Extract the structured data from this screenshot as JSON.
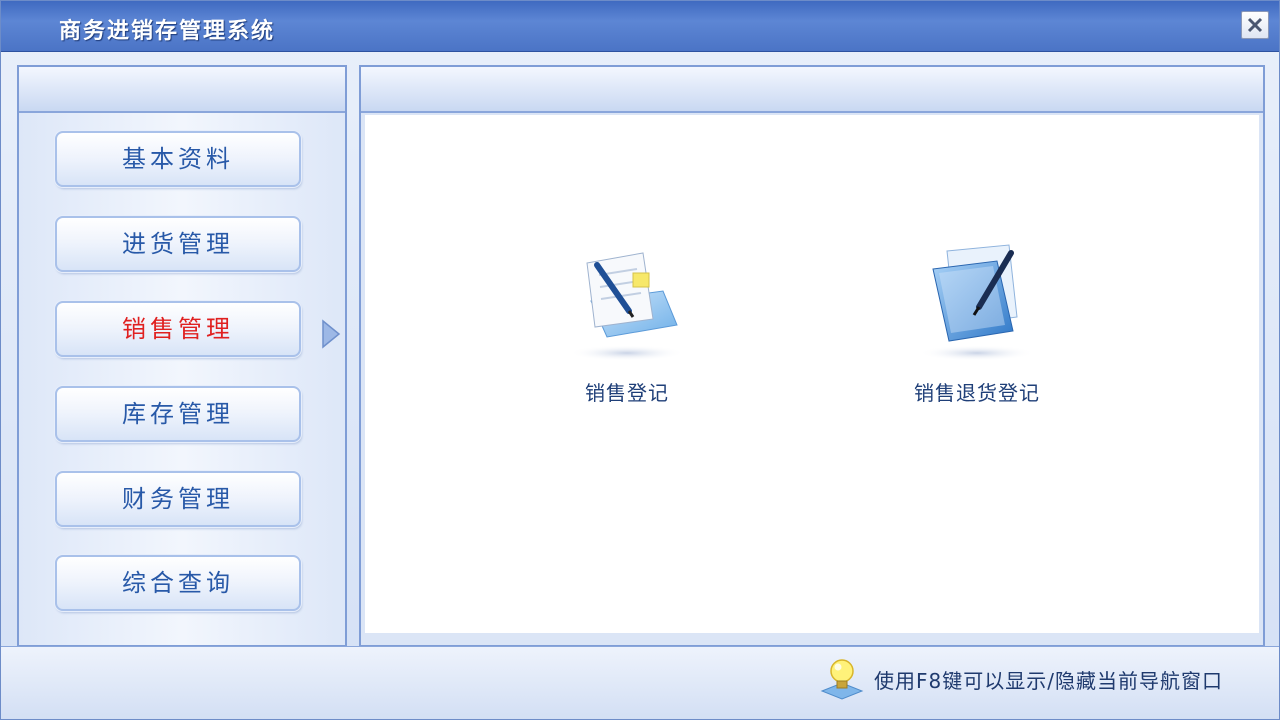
{
  "window": {
    "title": "商务进销存管理系统"
  },
  "nav": {
    "items": [
      {
        "label": "基本资料"
      },
      {
        "label": "进货管理"
      },
      {
        "label": "销售管理"
      },
      {
        "label": "库存管理"
      },
      {
        "label": "财务管理"
      },
      {
        "label": "综合查询"
      }
    ],
    "active_item": "销售管理"
  },
  "main": {
    "functions": [
      {
        "label": "销售登记",
        "icon": "sales-register-icon"
      },
      {
        "label": "销售退货登记",
        "icon": "sales-return-register-icon"
      }
    ]
  },
  "footer": {
    "hint": "使用F8键可以显示/隐藏当前导航窗口",
    "hint_icon": "lightbulb-icon"
  },
  "colors": {
    "title_bar": "#4b74c6",
    "nav_text": "#2859a8",
    "active_text": "#e02020",
    "panel_border": "#7f9dd6"
  }
}
